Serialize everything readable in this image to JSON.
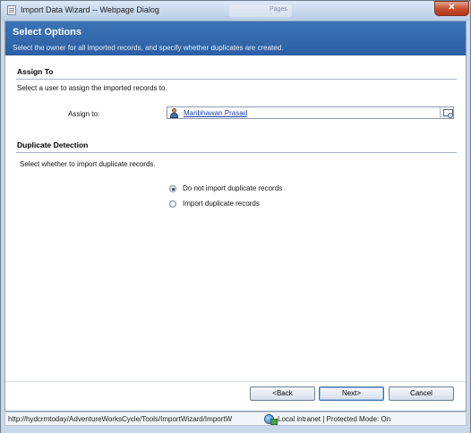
{
  "window": {
    "title": "Import Data Wizard -- Webpage Dialog",
    "background_tab_text": "Pages",
    "close_glyph": "✕"
  },
  "banner": {
    "title": "Select Options",
    "subtitle": "Select the owner for all imported records, and specify whether duplicates are created."
  },
  "assign": {
    "heading": "Assign To",
    "description": "Select a user to assign the imported records to.",
    "field_label": "Assign to:",
    "value": "Manbhawan Prasad",
    "value_icon": "user-icon",
    "lookup_icon": "lookup-icon"
  },
  "duplicate": {
    "heading": "Duplicate Detection",
    "description": "Select whether to import duplicate records.",
    "options": [
      {
        "label": "Do not import duplicate records",
        "selected": true
      },
      {
        "label": "Import duplicate records",
        "selected": false
      }
    ]
  },
  "buttons": {
    "back": "<Back",
    "next": "Next>",
    "cancel": "Cancel"
  },
  "statusbar": {
    "url": "http://hydcrmtoday/AdventureWorksCycle/Tools/ImportWizard/ImportW",
    "zone_icon": "globe-icon",
    "zone": "Local intranet | Protected Mode: On"
  },
  "colors": {
    "banner": "#2d5fa3",
    "link": "#1f3fa8",
    "close_button": "#c54a2c"
  }
}
